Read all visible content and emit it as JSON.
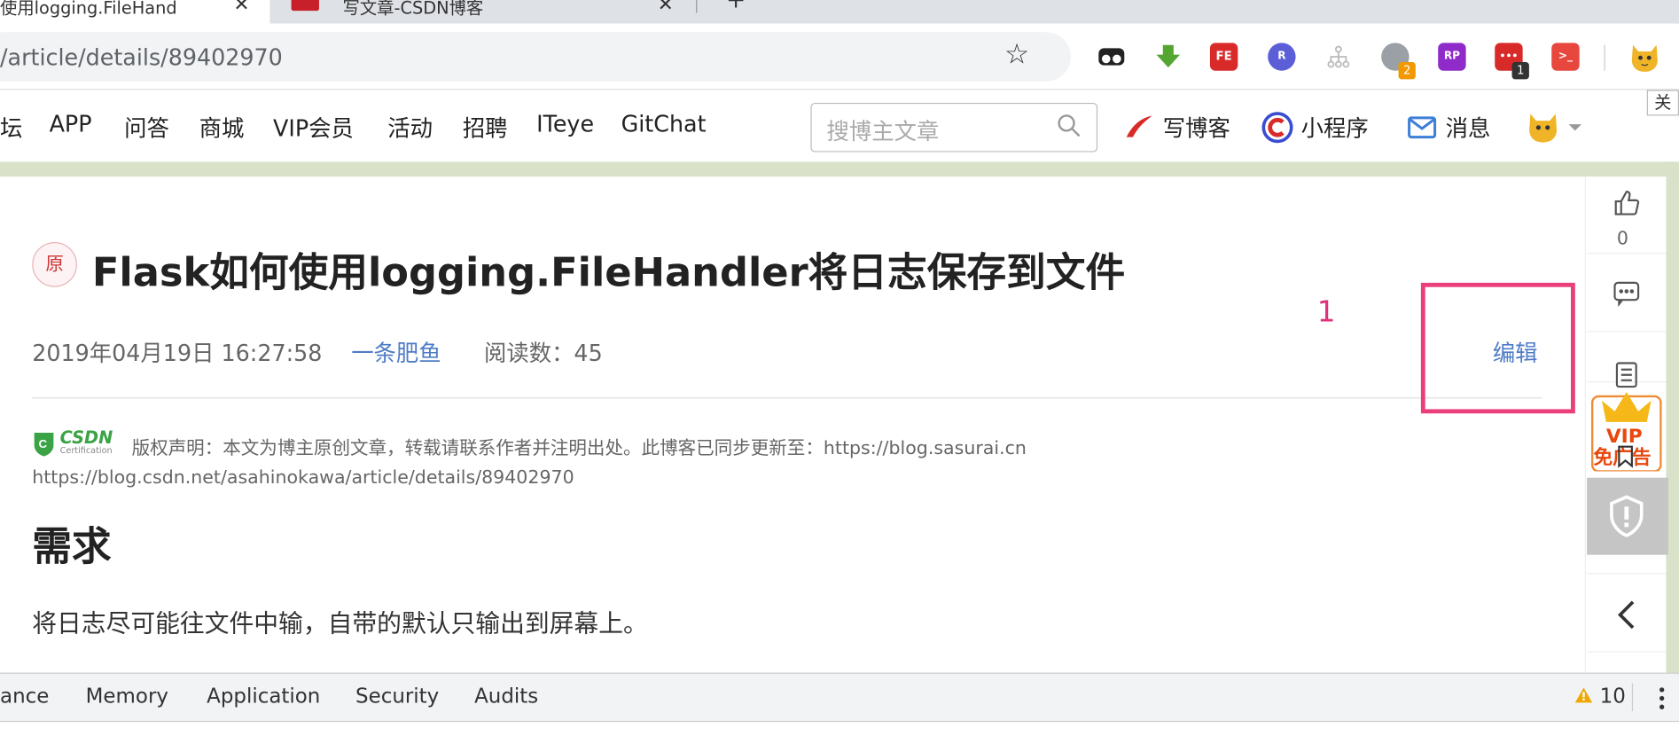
{
  "browser": {
    "tabs": [
      {
        "title": "使用logging.FileHand"
      },
      {
        "title": "写文章-CSDN博客"
      }
    ],
    "new_tab_label": "+",
    "url": "/article/details/89402970",
    "bookmark_icon": "star-icon",
    "extensions": [
      {
        "name": "tampermonkey-icon",
        "color": "#222222",
        "label": ""
      },
      {
        "name": "download-arrow-icon",
        "color": "#55a630",
        "label": ""
      },
      {
        "name": "fe-icon",
        "color": "#d92a2a",
        "label": "FE"
      },
      {
        "name": "r-icon",
        "color": "#5b5ed6",
        "label": "R"
      },
      {
        "name": "sitemap-icon",
        "color": "#bbbbbb",
        "label": ""
      },
      {
        "name": "chrome-ext-icon",
        "color": "#9aa0a6",
        "label": "",
        "badge": "2",
        "badge_color": "#f29900"
      },
      {
        "name": "rp-icon",
        "color": "#8e2bc9",
        "label": "RP"
      },
      {
        "name": "more-dots-icon",
        "color": "#d92a2a",
        "label": "•••",
        "badge": "1",
        "badge_color": "#333333"
      },
      {
        "name": "terminal-icon",
        "color": "#e8473e",
        "label": ">_"
      }
    ],
    "profile_icon": "cat-avatar-icon",
    "corner_text": "关"
  },
  "nav": {
    "items": [
      "坛",
      "APP",
      "问答",
      "商城",
      "VIP会员",
      "活动",
      "招聘",
      "ITeye",
      "GitChat"
    ],
    "search_placeholder": "搜博主文章",
    "write_label": "写博客",
    "miniprogram_label": "小程序",
    "message_label": "消息"
  },
  "article": {
    "original_badge": "原",
    "title": "Flask如何使用logging.FileHandler将日志保存到文件",
    "date": "2019年04月19日 16:27:58",
    "author": "一条肥鱼",
    "read_count": "阅读数：45",
    "edit_label": "编辑",
    "annotation_number": "1",
    "copyright": "版权声明：本文为博主原创文章，转载请联系作者并注明出处。此博客已同步更新至：https://blog.sasurai.cn",
    "original_link": "https://blog.csdn.net/asahinokawa/article/details/89402970",
    "section_heading": "需求",
    "paragraph": "将日志尽可能往文件中输，自带的默认只输出到屏幕上。",
    "csdn_logo_text": "CSDN",
    "csdn_logo_sub": "Certification"
  },
  "rail": {
    "like_count": "0",
    "vip_label": "VIP",
    "vip_sub": "免广告"
  },
  "devtools": {
    "tabs": [
      "ance",
      "Memory",
      "Application",
      "Security",
      "Audits"
    ],
    "warning_count": "10"
  },
  "colors": {
    "accent_pink": "#ea3f7b",
    "link_blue": "#4f7cc6"
  }
}
